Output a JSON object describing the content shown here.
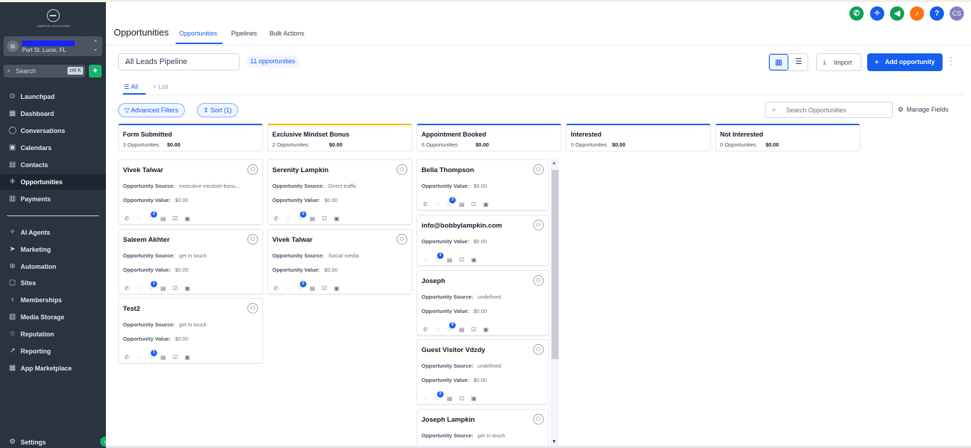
{
  "sidebar": {
    "logo_text": "LAMPKIN SOLUTIONS",
    "account": {
      "location": "Port St. Lucie, FL",
      "avatar_icon": "location-icon"
    },
    "search": {
      "placeholder": "Search",
      "shortcut": "ctrl K"
    },
    "items": [
      {
        "label": "Launchpad",
        "icon": "rocket-icon"
      },
      {
        "label": "Dashboard",
        "icon": "dashboard-icon"
      },
      {
        "label": "Conversations",
        "icon": "chat-icon"
      },
      {
        "label": "Calendars",
        "icon": "calendar-icon"
      },
      {
        "label": "Contacts",
        "icon": "contacts-icon"
      },
      {
        "label": "Opportunities",
        "icon": "opportunities-icon",
        "active": true
      },
      {
        "label": "Payments",
        "icon": "payments-icon"
      },
      {
        "label": "AI Agents",
        "icon": "sparkles-icon"
      },
      {
        "label": "Marketing",
        "icon": "send-icon"
      },
      {
        "label": "Automation",
        "icon": "automation-icon"
      },
      {
        "label": "Sites",
        "icon": "sites-icon"
      },
      {
        "label": "Memberships",
        "icon": "membership-icon"
      },
      {
        "label": "Media Storage",
        "icon": "media-icon"
      },
      {
        "label": "Reputation",
        "icon": "star-icon"
      },
      {
        "label": "Reporting",
        "icon": "trend-icon"
      },
      {
        "label": "App Marketplace",
        "icon": "grid-icon"
      },
      {
        "label": "Settings",
        "icon": "gear-icon"
      }
    ]
  },
  "header": {
    "title": "Opportunities",
    "tabs": [
      "Opportunities",
      "Pipelines",
      "Bulk Actions"
    ],
    "user_initials": "CS",
    "help_glyph": "?",
    "icon_colors": {
      "phone": "#0e9f55",
      "magic": "#155eef",
      "announce": "#0e9f55",
      "bell": "#f97316",
      "help": "#155eef",
      "user": "#7f7fc0"
    }
  },
  "toolbar": {
    "pipeline": "All Leads Pipeline",
    "count": "11 opportunities",
    "import": "Import",
    "add": "Add opportunity",
    "subtabs": [
      "All",
      "List"
    ],
    "advanced_filters": "Advanced Filters",
    "sort": "Sort (1)",
    "search_placeholder": "Search Opportunities",
    "manage_fields": "Manage Fields"
  },
  "columns": [
    {
      "name": "Form Submitted",
      "count": "3 Opportunities",
      "value": "$0.00",
      "color": "#155eef",
      "cards": [
        {
          "name": "Vivek Talwar",
          "source": "executive mindset-bonu...",
          "value": "$0.00",
          "badge": "2",
          "icons": 6
        },
        {
          "name": "Saleem Akhter",
          "source": "get in touch",
          "value": "$0.00",
          "badge": "1",
          "icons": 6
        },
        {
          "name": "Test2",
          "source": "get in touch",
          "value": "$0.00",
          "badge": "1",
          "icons": 6
        }
      ]
    },
    {
      "name": "Exclusive Mindset Bonus",
      "count": "2 Opportunities",
      "value": "$0.00",
      "color": "#f7b500",
      "cards": [
        {
          "name": "Serenity Lampkin",
          "source": "Direct traffic",
          "value": "$0.00",
          "badge": "2",
          "icons": 6
        },
        {
          "name": "Vivek Talwar",
          "source": "Social media",
          "value": "$0.00",
          "badge": "2",
          "icons": 6
        }
      ]
    },
    {
      "name": "Appointment Booked",
      "count": "6 Opportunities",
      "value": "$0.00",
      "color": "#155eef",
      "cards": [
        {
          "name": "Bella Thompson",
          "source": null,
          "value": "$0.00",
          "badge": "3",
          "icons": 6
        },
        {
          "name": "info@bobbylampkin.com",
          "source": null,
          "value": "$0.00",
          "badge": "1",
          "icons": 5
        },
        {
          "name": "Joseph",
          "source": "undefined",
          "value": "$0.00",
          "badge": "9",
          "icons": 6
        },
        {
          "name": "Guest Visitor Vdzdy",
          "source": "undefined",
          "value": "$0.00",
          "badge": "2",
          "icons": 5
        },
        {
          "name": "Joseph Lampkin",
          "source": "get in touch",
          "value": null,
          "badge": null,
          "icons": 0
        }
      ]
    },
    {
      "name": "Interested",
      "count": "0 Opportunities",
      "value": "$0.00",
      "color": "#155eef",
      "cards": []
    },
    {
      "name": "Not Interested",
      "count": "0 Opportunities",
      "value": "$0.00",
      "color": "#155eef",
      "cards": []
    }
  ],
  "labels": {
    "source": "Opportunity Source:",
    "value": "Opportunity Value:"
  }
}
